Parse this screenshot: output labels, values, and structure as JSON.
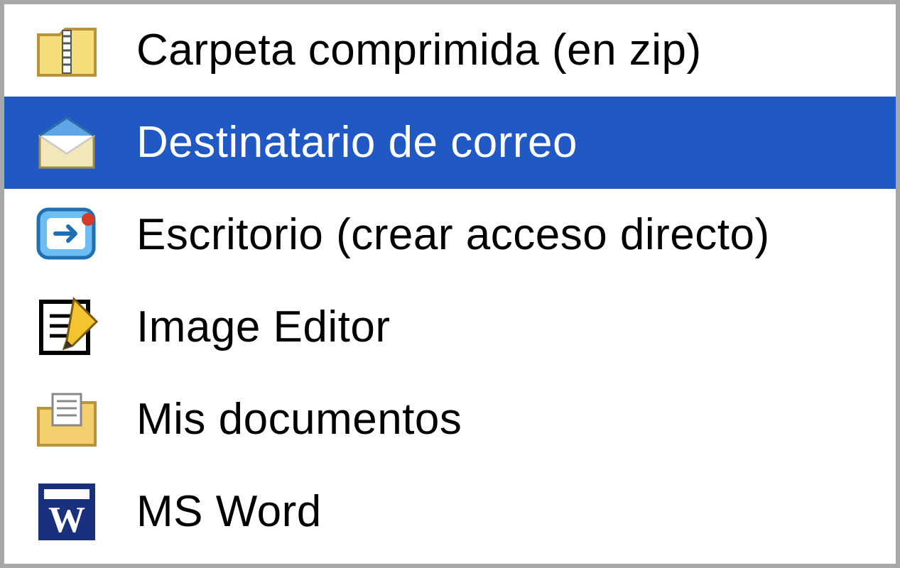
{
  "menu": {
    "items": [
      {
        "id": "zip",
        "label": "Carpeta comprimida (en zip)",
        "selected": false,
        "icon": "zip-folder-icon"
      },
      {
        "id": "mail",
        "label": "Destinatario de correo",
        "selected": true,
        "icon": "mail-envelope-icon"
      },
      {
        "id": "desktop",
        "label": "Escritorio (crear acceso directo)",
        "selected": false,
        "icon": "desktop-shortcut-icon"
      },
      {
        "id": "imged",
        "label": "Image Editor",
        "selected": false,
        "icon": "edit-note-icon"
      },
      {
        "id": "mydocs",
        "label": "Mis documentos",
        "selected": false,
        "icon": "documents-folder-icon"
      },
      {
        "id": "msword",
        "label": "MS Word",
        "selected": false,
        "icon": "ms-word-icon"
      }
    ]
  },
  "colors": {
    "selection_bg": "#2159c4",
    "selection_fg": "#ffffff",
    "border": "#a8a8a8",
    "text": "#000000"
  }
}
